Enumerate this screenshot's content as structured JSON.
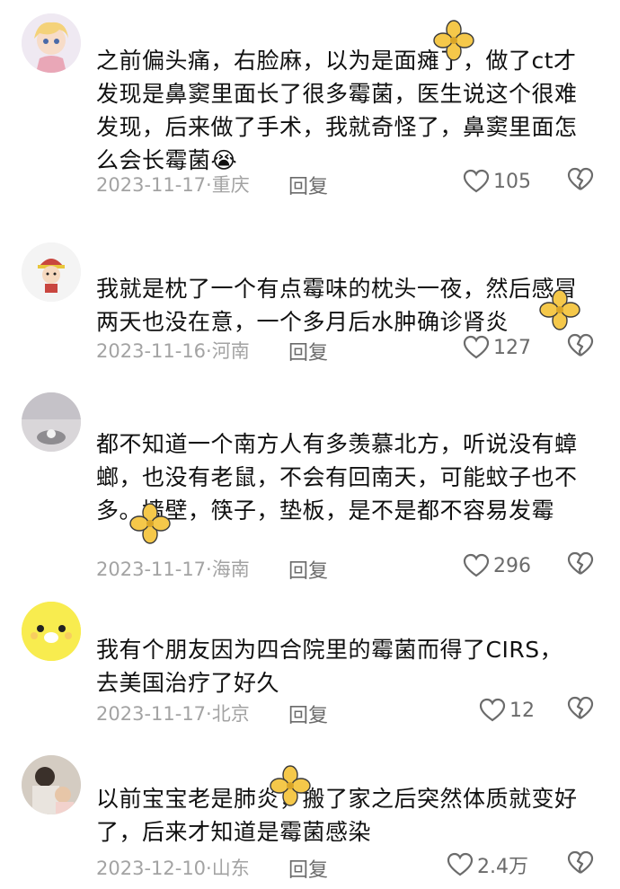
{
  "comments": [
    {
      "text": "之前偏头痛，右脸麻，以为是面瘫了，做了ct才发现是鼻窦里面长了很多霉菌，医生说这个很难发现，后来做了手术，我就奇怪了，鼻窦里面怎么会长霉菌😭",
      "date": "2023-11-17",
      "location": "重庆",
      "reply_label": "回复",
      "likes": "105",
      "avatar_icon": "anime-girl-avatar-icon"
    },
    {
      "text": "我就是枕了一个有点霉味的枕头一夜，然后感冒两天也没在意，一个多月后水肿确诊肾炎",
      "date": "2023-11-16",
      "location": "河南",
      "reply_label": "回复",
      "likes": "127",
      "avatar_icon": "cartoon-boy-avatar-icon"
    },
    {
      "text": "都不知道一个南方人有多羡慕北方，听说没有蟑螂，也没有老鼠，不会有回南天，可能蚊子也不多。墙壁，筷子，垫板，是不是都不容易发霉",
      "date": "2023-11-17",
      "location": "海南",
      "reply_label": "回复",
      "likes": "296",
      "avatar_icon": "photo-avatar-icon"
    },
    {
      "text": "我有个朋友因为四合院里的霉菌而得了CIRS，去美国治疗了好久",
      "date": "2023-11-17",
      "location": "北京",
      "reply_label": "回复",
      "likes": "12",
      "avatar_icon": "yellow-chick-avatar-icon"
    },
    {
      "text": "以前宝宝老是肺炎，搬了家之后突然体质就变好了，后来才知道是霉菌感染",
      "date": "2023-12-10",
      "location": "山东",
      "reply_label": "回复",
      "likes": "2.4万",
      "avatar_icon": "photo-avatar-icon"
    }
  ],
  "colors": {
    "text": "#111111",
    "meta": "#a3a3a3",
    "icon": "#6b6b6b",
    "sticker": "#f5c84a"
  }
}
